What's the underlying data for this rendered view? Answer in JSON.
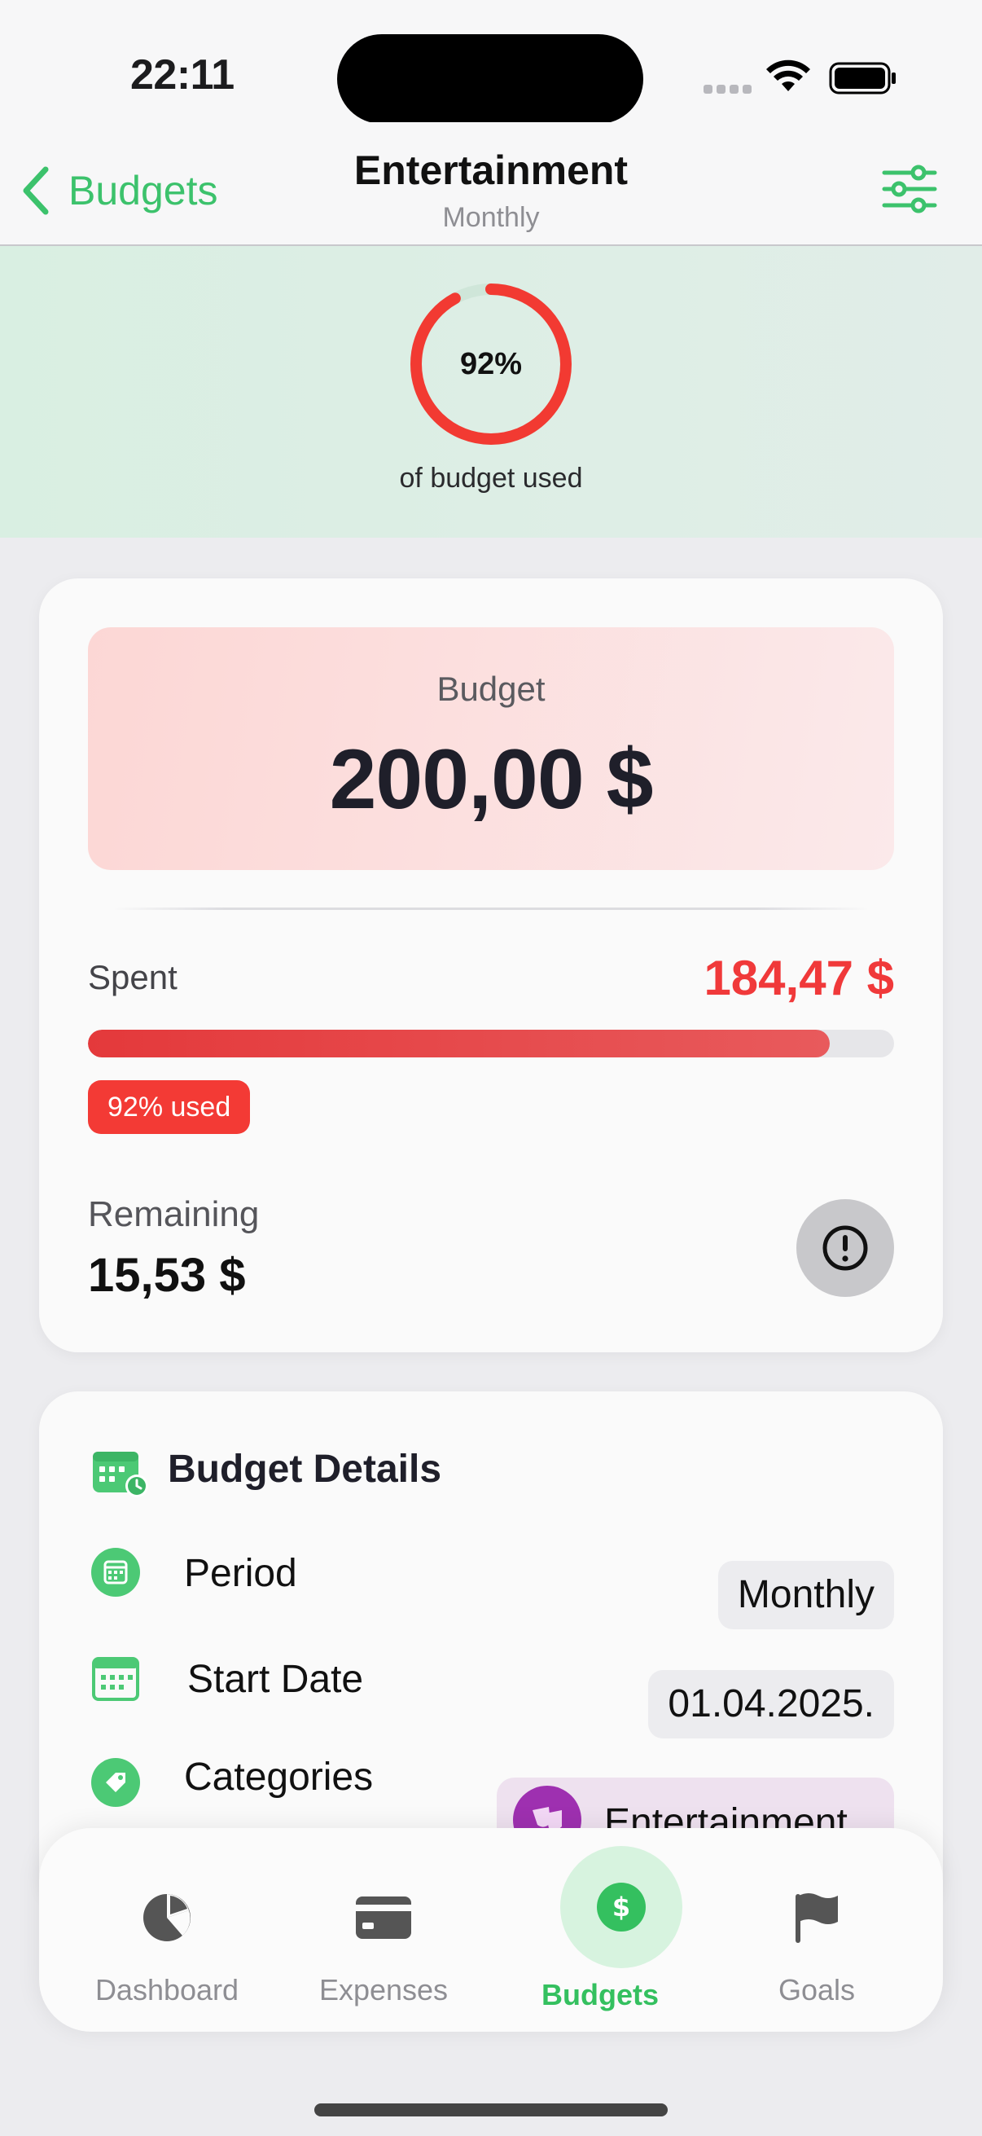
{
  "status_bar": {
    "time": "22:11"
  },
  "nav": {
    "back_label": "Budgets",
    "title": "Entertainment",
    "subtitle": "Monthly",
    "filter_icon": "sliders-icon"
  },
  "hero": {
    "percent_text": "92%",
    "percent_value": 0.92,
    "caption": "of budget used",
    "ring_color": "#f23a32"
  },
  "budget_card": {
    "budget_label": "Budget",
    "budget_value": "200,00 $",
    "spent_label": "Spent",
    "spent_value": "184,47 $",
    "progress_fraction": 0.92,
    "used_badge": "92% used",
    "remaining_label": "Remaining",
    "remaining_value": "15,53 $",
    "alert_icon": "exclamation-circle-icon"
  },
  "details_card": {
    "title": "Budget Details",
    "rows": [
      {
        "label": "Period",
        "value": "Monthly",
        "icon": "calendar-icon"
      },
      {
        "label": "Start Date",
        "value": "01.04.2025.",
        "icon": "calendar-grid-icon"
      },
      {
        "label": "Categories",
        "value": "Entertainment",
        "icon": "tag-icon"
      }
    ]
  },
  "tabbar": {
    "tabs": [
      {
        "label": "Dashboard",
        "icon": "pie-chart-icon",
        "active": false
      },
      {
        "label": "Expenses",
        "icon": "credit-card-icon",
        "active": false
      },
      {
        "label": "Budgets",
        "icon": "dollar-circle-icon",
        "active": true
      },
      {
        "label": "Goals",
        "icon": "flag-icon",
        "active": false
      }
    ]
  },
  "colors": {
    "accent": "#34c05f",
    "danger": "#f0393a",
    "category": "#9e30b0"
  }
}
